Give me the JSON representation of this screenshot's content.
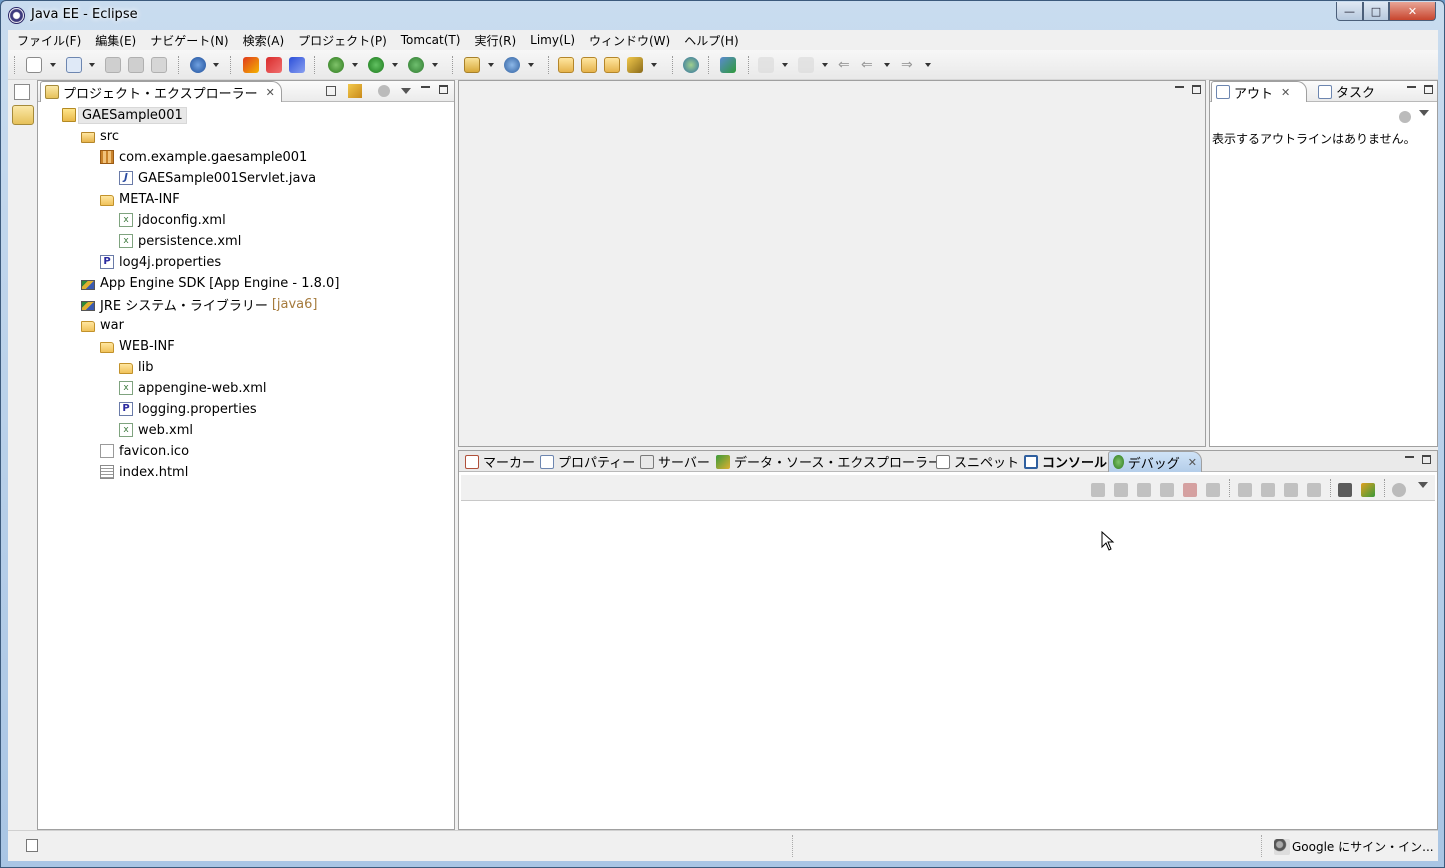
{
  "window": {
    "title": "Java EE - Eclipse"
  },
  "menubar": {
    "items": [
      "ファイル(F)",
      "編集(E)",
      "ナビゲート(N)",
      "検索(A)",
      "プロジェクト(P)",
      "Tomcat(T)",
      "実行(R)",
      "Limy(L)",
      "ウィンドウ(W)",
      "ヘルプ(H)"
    ]
  },
  "project_explorer": {
    "tab_label": "プロジェクト・エクスプローラー",
    "tree": [
      {
        "label": "GAESample001",
        "icon": "project-icon",
        "selected": true
      },
      {
        "label": "src",
        "icon": "source-folder-icon"
      },
      {
        "label": "com.example.gaesample001",
        "icon": "package-icon"
      },
      {
        "label": "GAESample001Servlet.java",
        "icon": "java-file-icon"
      },
      {
        "label": "META-INF",
        "icon": "folder-icon"
      },
      {
        "label": "jdoconfig.xml",
        "icon": "xml-file-icon"
      },
      {
        "label": "persistence.xml",
        "icon": "xml-file-icon"
      },
      {
        "label": "log4j.properties",
        "icon": "properties-file-icon"
      },
      {
        "label": "App Engine SDK [App Engine - 1.8.0]",
        "icon": "library-icon"
      },
      {
        "label": "JRE システム・ライブラリー",
        "decoration": "[java6]",
        "icon": "library-icon"
      },
      {
        "label": "war",
        "icon": "folder-icon"
      },
      {
        "label": "WEB-INF",
        "icon": "folder-icon"
      },
      {
        "label": "lib",
        "icon": "folder-icon"
      },
      {
        "label": "appengine-web.xml",
        "icon": "xml-file-icon"
      },
      {
        "label": "logging.properties",
        "icon": "properties-file-icon"
      },
      {
        "label": "web.xml",
        "icon": "xml-file-icon"
      },
      {
        "label": "favicon.ico",
        "icon": "file-icon"
      },
      {
        "label": "index.html",
        "icon": "html-file-icon"
      }
    ]
  },
  "outline": {
    "tabs": [
      "アウト",
      "タスク"
    ],
    "message": "表示するアウトラインはありません。"
  },
  "bottom_panel": {
    "tabs": [
      {
        "label": "マーカー",
        "icon": "markers-icon"
      },
      {
        "label": "プロパティー",
        "icon": "properties-view-icon"
      },
      {
        "label": "サーバー",
        "icon": "servers-icon"
      },
      {
        "label": "データ・ソース・エクスプローラー",
        "icon": "data-source-icon"
      },
      {
        "label": "スニペット",
        "icon": "snippets-icon"
      },
      {
        "label": "コンソール",
        "icon": "console-icon"
      },
      {
        "label": "デバッグ",
        "icon": "debug-icon",
        "active": true
      }
    ]
  },
  "statusbar": {
    "google_signin": "Google にサイン・イン..."
  }
}
